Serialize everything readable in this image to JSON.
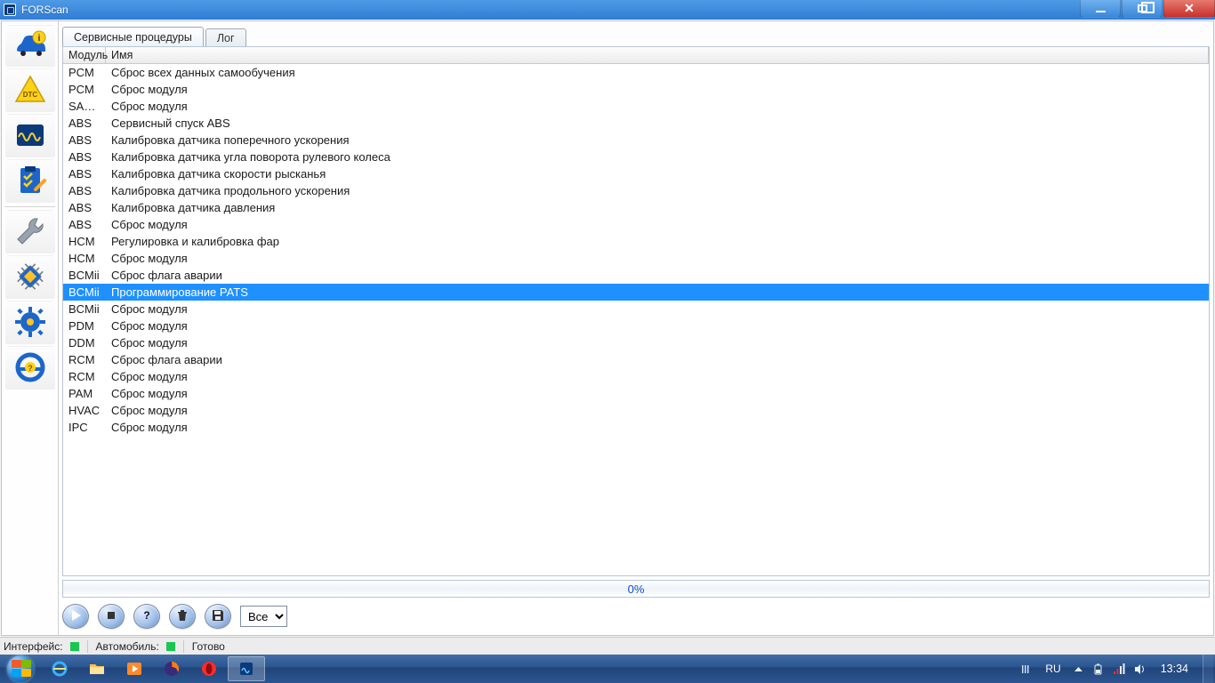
{
  "window": {
    "title": "FORScan"
  },
  "tabs": [
    {
      "label": "Сервисные процедуры",
      "active": true
    },
    {
      "label": "Лог",
      "active": false
    }
  ],
  "columns": {
    "module": "Модуль",
    "name": "Имя"
  },
  "rows": [
    {
      "module": "PCM",
      "name": "Сброс всех данных самообучения"
    },
    {
      "module": "PCM",
      "name": "Сброс модуля"
    },
    {
      "module": "SASM",
      "name": "Сброс модуля"
    },
    {
      "module": "ABS",
      "name": "Сервисный спуск ABS"
    },
    {
      "module": "ABS",
      "name": "Калибровка датчика поперечного ускорения"
    },
    {
      "module": "ABS",
      "name": "Калибровка датчика угла поворота рулевого колеса"
    },
    {
      "module": "ABS",
      "name": "Калибровка датчика скорости рысканья"
    },
    {
      "module": "ABS",
      "name": "Калибровка датчика продольного ускорения"
    },
    {
      "module": "ABS",
      "name": "Калибровка датчика давления"
    },
    {
      "module": "ABS",
      "name": "Сброс модуля"
    },
    {
      "module": "HCM",
      "name": "Регулировка и калибровка фар"
    },
    {
      "module": "HCM",
      "name": "Сброс модуля"
    },
    {
      "module": "BCMii",
      "name": "Сброс флага аварии"
    },
    {
      "module": "BCMii",
      "name": "Программирование PATS",
      "selected": true
    },
    {
      "module": "BCMii",
      "name": "Сброс модуля"
    },
    {
      "module": "PDM",
      "name": "Сброс модуля"
    },
    {
      "module": "DDM",
      "name": "Сброс модуля"
    },
    {
      "module": "RCM",
      "name": "Сброс флага аварии"
    },
    {
      "module": "RCM",
      "name": "Сброс модуля"
    },
    {
      "module": "PAM",
      "name": "Сброс модуля"
    },
    {
      "module": "HVAC",
      "name": "Сброс модуля"
    },
    {
      "module": "IPC",
      "name": "Сброс модуля"
    }
  ],
  "progress": {
    "text": "0%"
  },
  "toolbar": {
    "filter_options": [
      "Все"
    ],
    "filter_selected": "Все"
  },
  "statusbar": {
    "interface_label": "Интерфейс:",
    "vehicle_label": "Автомобиль:",
    "ready_label": "Готово"
  },
  "sidebar": [
    {
      "id": "vehicle-info",
      "icon": "car-info"
    },
    {
      "id": "dtc",
      "icon": "dtc-warning"
    },
    {
      "id": "live-data",
      "icon": "oscilloscope"
    },
    {
      "id": "tests",
      "icon": "clipboard-check"
    },
    {
      "id": "service",
      "icon": "wrench"
    },
    {
      "id": "config",
      "icon": "chip"
    },
    {
      "id": "settings",
      "icon": "gear"
    },
    {
      "id": "help",
      "icon": "steering-help"
    }
  ],
  "taskbar": {
    "items": [
      {
        "name": "internet-explorer",
        "color": "#3ab0ff"
      },
      {
        "name": "file-explorer",
        "color": "#ffc14d"
      },
      {
        "name": "media-player",
        "color": "#ff8a2a"
      },
      {
        "name": "firefox",
        "color": "#ff7a18"
      },
      {
        "name": "opera",
        "color": "#ff2a2a"
      },
      {
        "name": "forscan",
        "color": "#66c2ff",
        "active": true
      }
    ],
    "lang": "RU",
    "clock": "13:34"
  }
}
